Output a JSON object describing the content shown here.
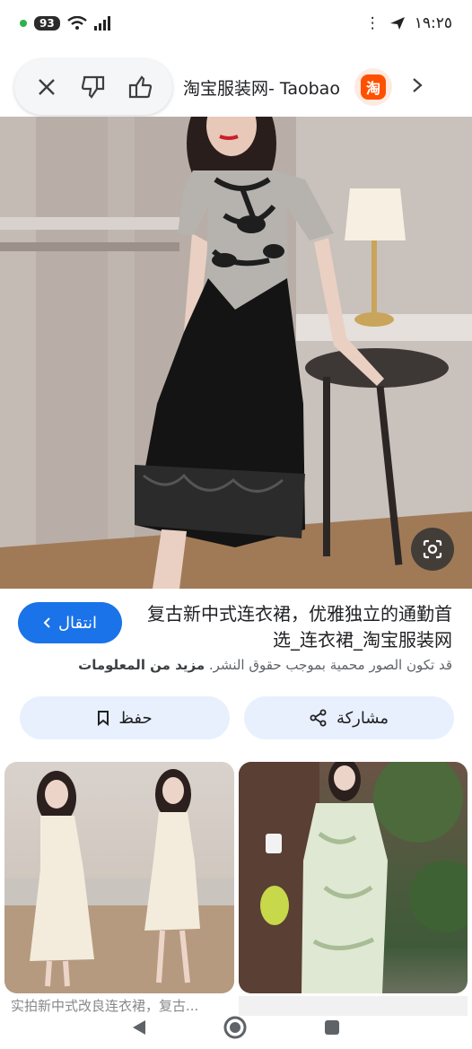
{
  "status_bar": {
    "battery": "93",
    "time": "١٩:٢٥",
    "more_glyph": "⋮"
  },
  "app_bar": {
    "site_title": "淘宝服装网- Taobao",
    "logo_glyph": "淘",
    "icons": [
      "close-icon",
      "thumbs-down-icon",
      "thumbs-up-icon",
      "chevron-right-icon"
    ]
  },
  "hero": {
    "alt": "复古新中式连衣裙"
  },
  "result": {
    "visit_label": "انتقال",
    "title": "复古新中式连衣裙，优雅独立的通勤首选_连衣裙_淘宝服装网",
    "copyright_text": "قد تكون الصور محمية بموجب حقوق النشر.",
    "learn_more": "مزيد من المعلومات"
  },
  "actions": {
    "save_label": "حفظ",
    "share_label": "مشاركة"
  },
  "related": {
    "left_caption": "实拍新中式改良连衣裙，复古..."
  },
  "colors": {
    "accent": "#1a73e8",
    "pill_bg": "#e8f0fe",
    "taobao_orange": "#ff5000"
  }
}
